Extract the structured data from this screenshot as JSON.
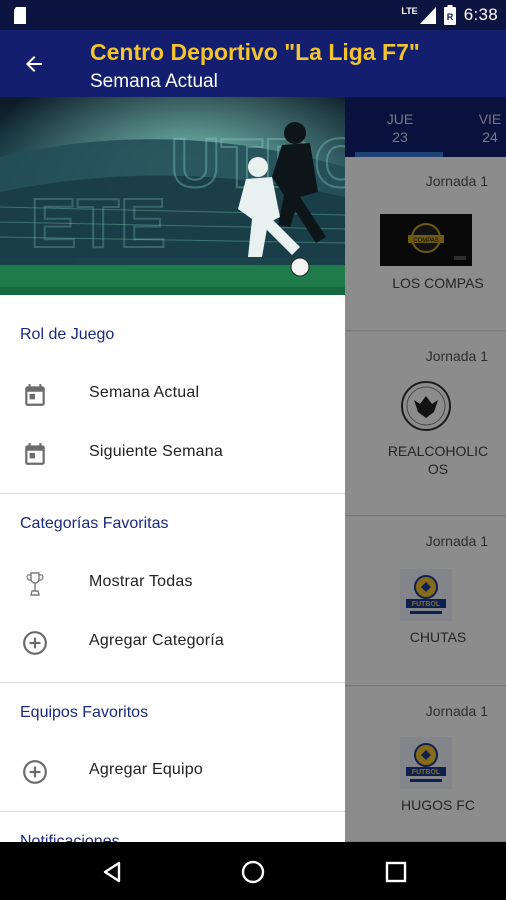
{
  "status_bar": {
    "network_label": "LTE",
    "battery_level_label": "R",
    "time": "6:38"
  },
  "app_bar": {
    "title": "Centro Deportivo \"La Liga F7\"",
    "subtitle": "Semana Actual",
    "title_color": "#f4c430",
    "background_color": "#131f6e"
  },
  "day_tabs": [
    {
      "day": "JUE",
      "date": "23",
      "selected": true
    },
    {
      "day": "VIE",
      "date": "24",
      "selected": false
    }
  ],
  "matches": [
    {
      "jornada": "Jornada 1",
      "team_line1": "LOS COMPAS",
      "team_line2": "",
      "logo_icon": "los-compas-logo"
    },
    {
      "jornada": "Jornada 1",
      "team_line1": "REALCOHOLIC",
      "team_line2": "OS",
      "logo_icon": "eagle-crest-logo"
    },
    {
      "jornada": "Jornada 1",
      "team_line1": "CHUTAS",
      "team_line2": "",
      "logo_icon": "futbol-league-logo"
    },
    {
      "jornada": "Jornada 1",
      "team_line1": "HUGOS FC",
      "team_line2": "",
      "logo_icon": "futbol-league-logo"
    }
  ],
  "drawer": {
    "sections": [
      {
        "title": "Rol de Juego",
        "items": [
          {
            "label": "Semana Actual",
            "icon": "calendar-icon"
          },
          {
            "label": "Siguiente Semana",
            "icon": "calendar-icon"
          }
        ]
      },
      {
        "title": "Categorías Favoritas",
        "items": [
          {
            "label": "Mostrar Todas",
            "icon": "trophy-icon"
          },
          {
            "label": "Agregar Categoría",
            "icon": "add-circle-icon"
          }
        ]
      },
      {
        "title": "Equipos Favoritos",
        "items": [
          {
            "label": "Agregar Equipo",
            "icon": "add-circle-icon"
          }
        ]
      },
      {
        "title": "Notificaciones",
        "items": []
      }
    ]
  },
  "nav_bar": {
    "buttons": [
      "back-icon",
      "home-icon",
      "recents-icon"
    ]
  }
}
